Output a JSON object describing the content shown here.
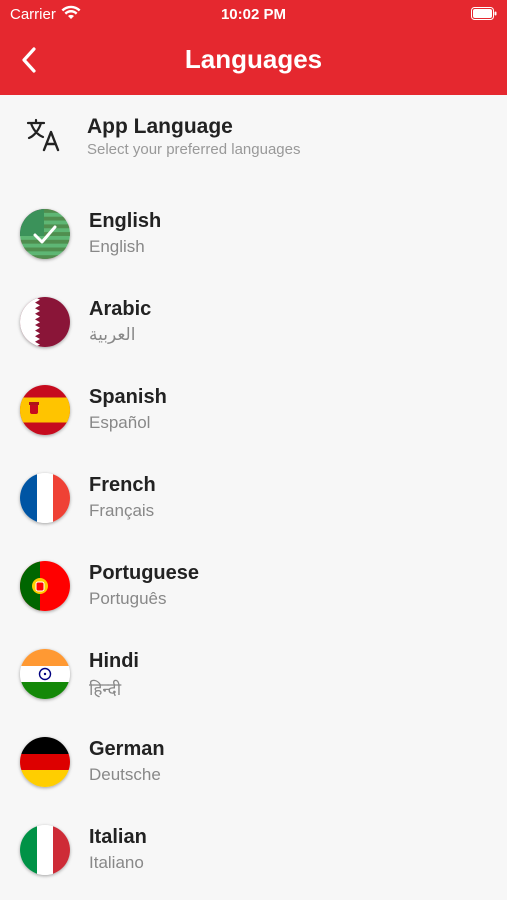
{
  "status": {
    "carrier": "Carrier",
    "time": "10:02 PM"
  },
  "header": {
    "title": "Languages"
  },
  "app_language": {
    "title": "App Language",
    "subtitle": "Select your preferred languages"
  },
  "languages": [
    {
      "name": "English",
      "native": "English",
      "flag": "us-flag-selected",
      "selected": true
    },
    {
      "name": "Arabic",
      "native": "العربية",
      "flag": "qatar-flag"
    },
    {
      "name": "Spanish",
      "native": "Español",
      "flag": "spain-flag"
    },
    {
      "name": "French",
      "native": "Français",
      "flag": "france-flag"
    },
    {
      "name": "Portuguese",
      "native": "Português",
      "flag": "portugal-flag"
    },
    {
      "name": "Hindi",
      "native": "हिन्दी",
      "flag": "india-flag"
    },
    {
      "name": "German",
      "native": "Deutsche",
      "flag": "germany-flag"
    },
    {
      "name": "Italian",
      "native": "Italiano",
      "flag": "italy-flag"
    }
  ],
  "colors": {
    "accent": "#e5282f",
    "selected_overlay": "#3aa655"
  }
}
